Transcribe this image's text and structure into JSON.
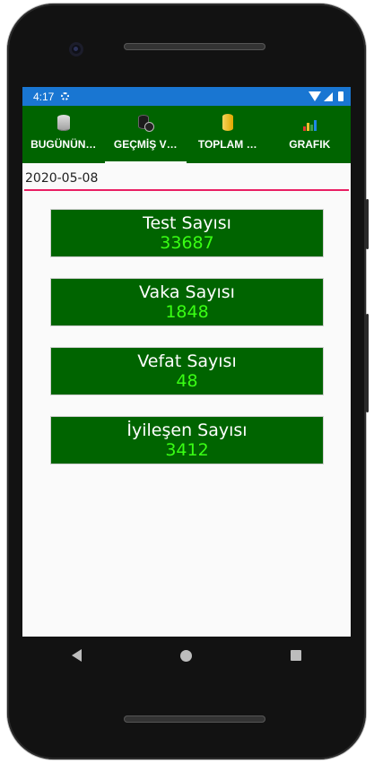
{
  "status_bar": {
    "time": "4:17"
  },
  "tabs": [
    {
      "label": "BUGÜNÜN…",
      "icon": "database-silver-icon"
    },
    {
      "label": "GEÇMİŞ V…",
      "icon": "database-history-icon"
    },
    {
      "label": "TOPLAM …",
      "icon": "gold-cylinder-icon"
    },
    {
      "label": "GRAFIK",
      "icon": "bar-chart-icon"
    }
  ],
  "active_tab": 1,
  "date_input": {
    "value": "2020-05-08"
  },
  "stats": [
    {
      "title": "Test Sayısı",
      "value": "33687"
    },
    {
      "title": "Vaka Sayısı",
      "value": "1848"
    },
    {
      "title": "Vefat Sayısı",
      "value": "48"
    },
    {
      "title": "İyileşen Sayısı",
      "value": "3412"
    }
  ],
  "colors": {
    "tab_bar": "#006400",
    "card_bg": "#006400",
    "value_text": "#39ff14",
    "status_bar": "#1976d2",
    "input_underline": "#e91e63"
  }
}
